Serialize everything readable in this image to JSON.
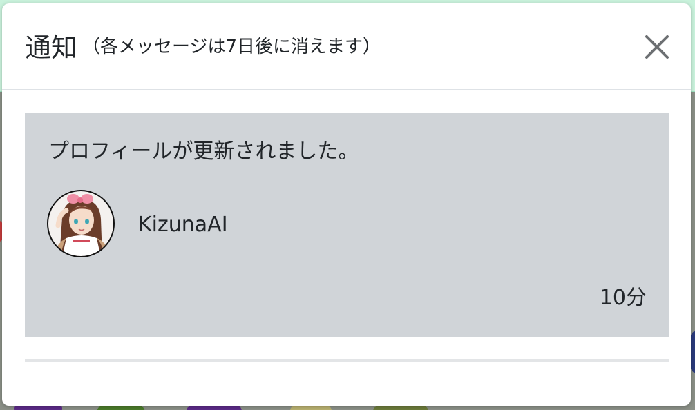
{
  "modal": {
    "title": "通知",
    "subtitle": "（各メッセージは7日後に消えます）",
    "close_icon": "close-icon"
  },
  "notifications": [
    {
      "message": "プロフィールが更新されました。",
      "user": {
        "name": "KizunaAI",
        "avatar_icon": "avatar-image"
      },
      "time": "10分"
    }
  ],
  "colors": {
    "card_background": "#d0d4d8",
    "modal_background": "#ffffff",
    "text": "#212529",
    "backdrop_accent": "#c9f2dc"
  }
}
